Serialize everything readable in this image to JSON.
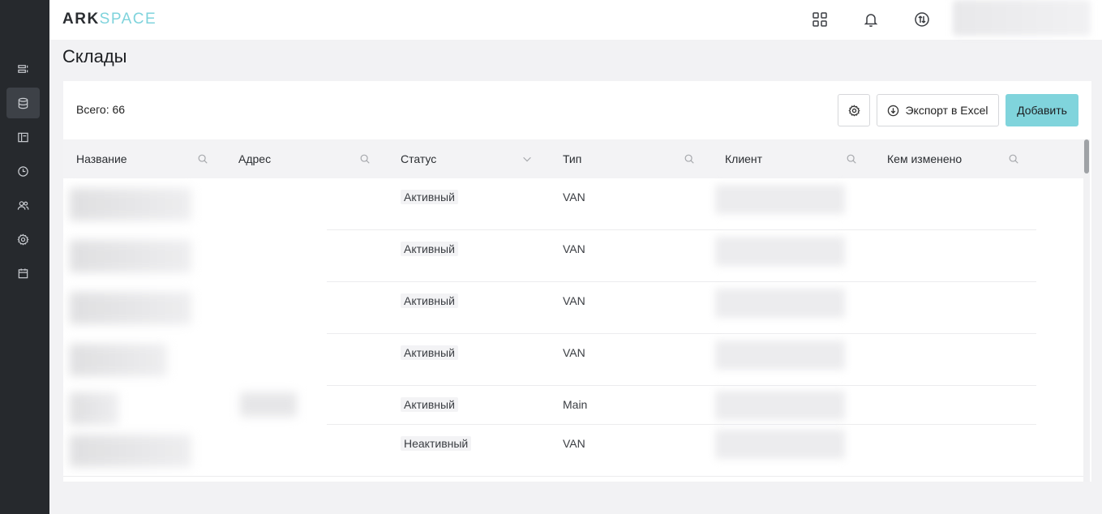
{
  "sidebar": {
    "items": [
      {
        "icon": "list-icon",
        "active": false
      },
      {
        "icon": "database-icon",
        "active": true
      },
      {
        "icon": "layout-icon",
        "active": false
      },
      {
        "icon": "clock-icon",
        "active": false
      },
      {
        "icon": "users-icon",
        "active": false
      },
      {
        "icon": "gear-icon",
        "active": false
      },
      {
        "icon": "calendar-icon",
        "active": false
      }
    ]
  },
  "header": {
    "logo_ark": "ARK",
    "logo_space": "SPACE",
    "icons": [
      "apps-grid-icon",
      "bell-icon",
      "swap-icon"
    ]
  },
  "page": {
    "title": "Склады"
  },
  "toolbar": {
    "total_label": "Всего: 66",
    "export_label": "Экспорт в Excel",
    "add_label": "Добавить"
  },
  "table": {
    "columns": [
      {
        "label": "Название",
        "icon": "search-icon"
      },
      {
        "label": "Адрес",
        "icon": "search-icon"
      },
      {
        "label": "Статус",
        "icon": "chevron-down-icon"
      },
      {
        "label": "Тип",
        "icon": "search-icon"
      },
      {
        "label": "Клиент",
        "icon": "search-icon"
      },
      {
        "label": "Кем изменено",
        "icon": "search-icon"
      }
    ],
    "rows": [
      {
        "status": "Активный",
        "type": "VAN"
      },
      {
        "status": "Активный",
        "type": "VAN"
      },
      {
        "status": "Активный",
        "type": "VAN"
      },
      {
        "status": "Активный",
        "type": "VAN"
      },
      {
        "status": "Активный",
        "type": "Main"
      },
      {
        "status": "Неактивный",
        "type": "VAN"
      }
    ]
  },
  "colors": {
    "sidebar_bg": "#26292d",
    "accent": "#80d4dc",
    "page_bg": "#f2f2f4"
  }
}
